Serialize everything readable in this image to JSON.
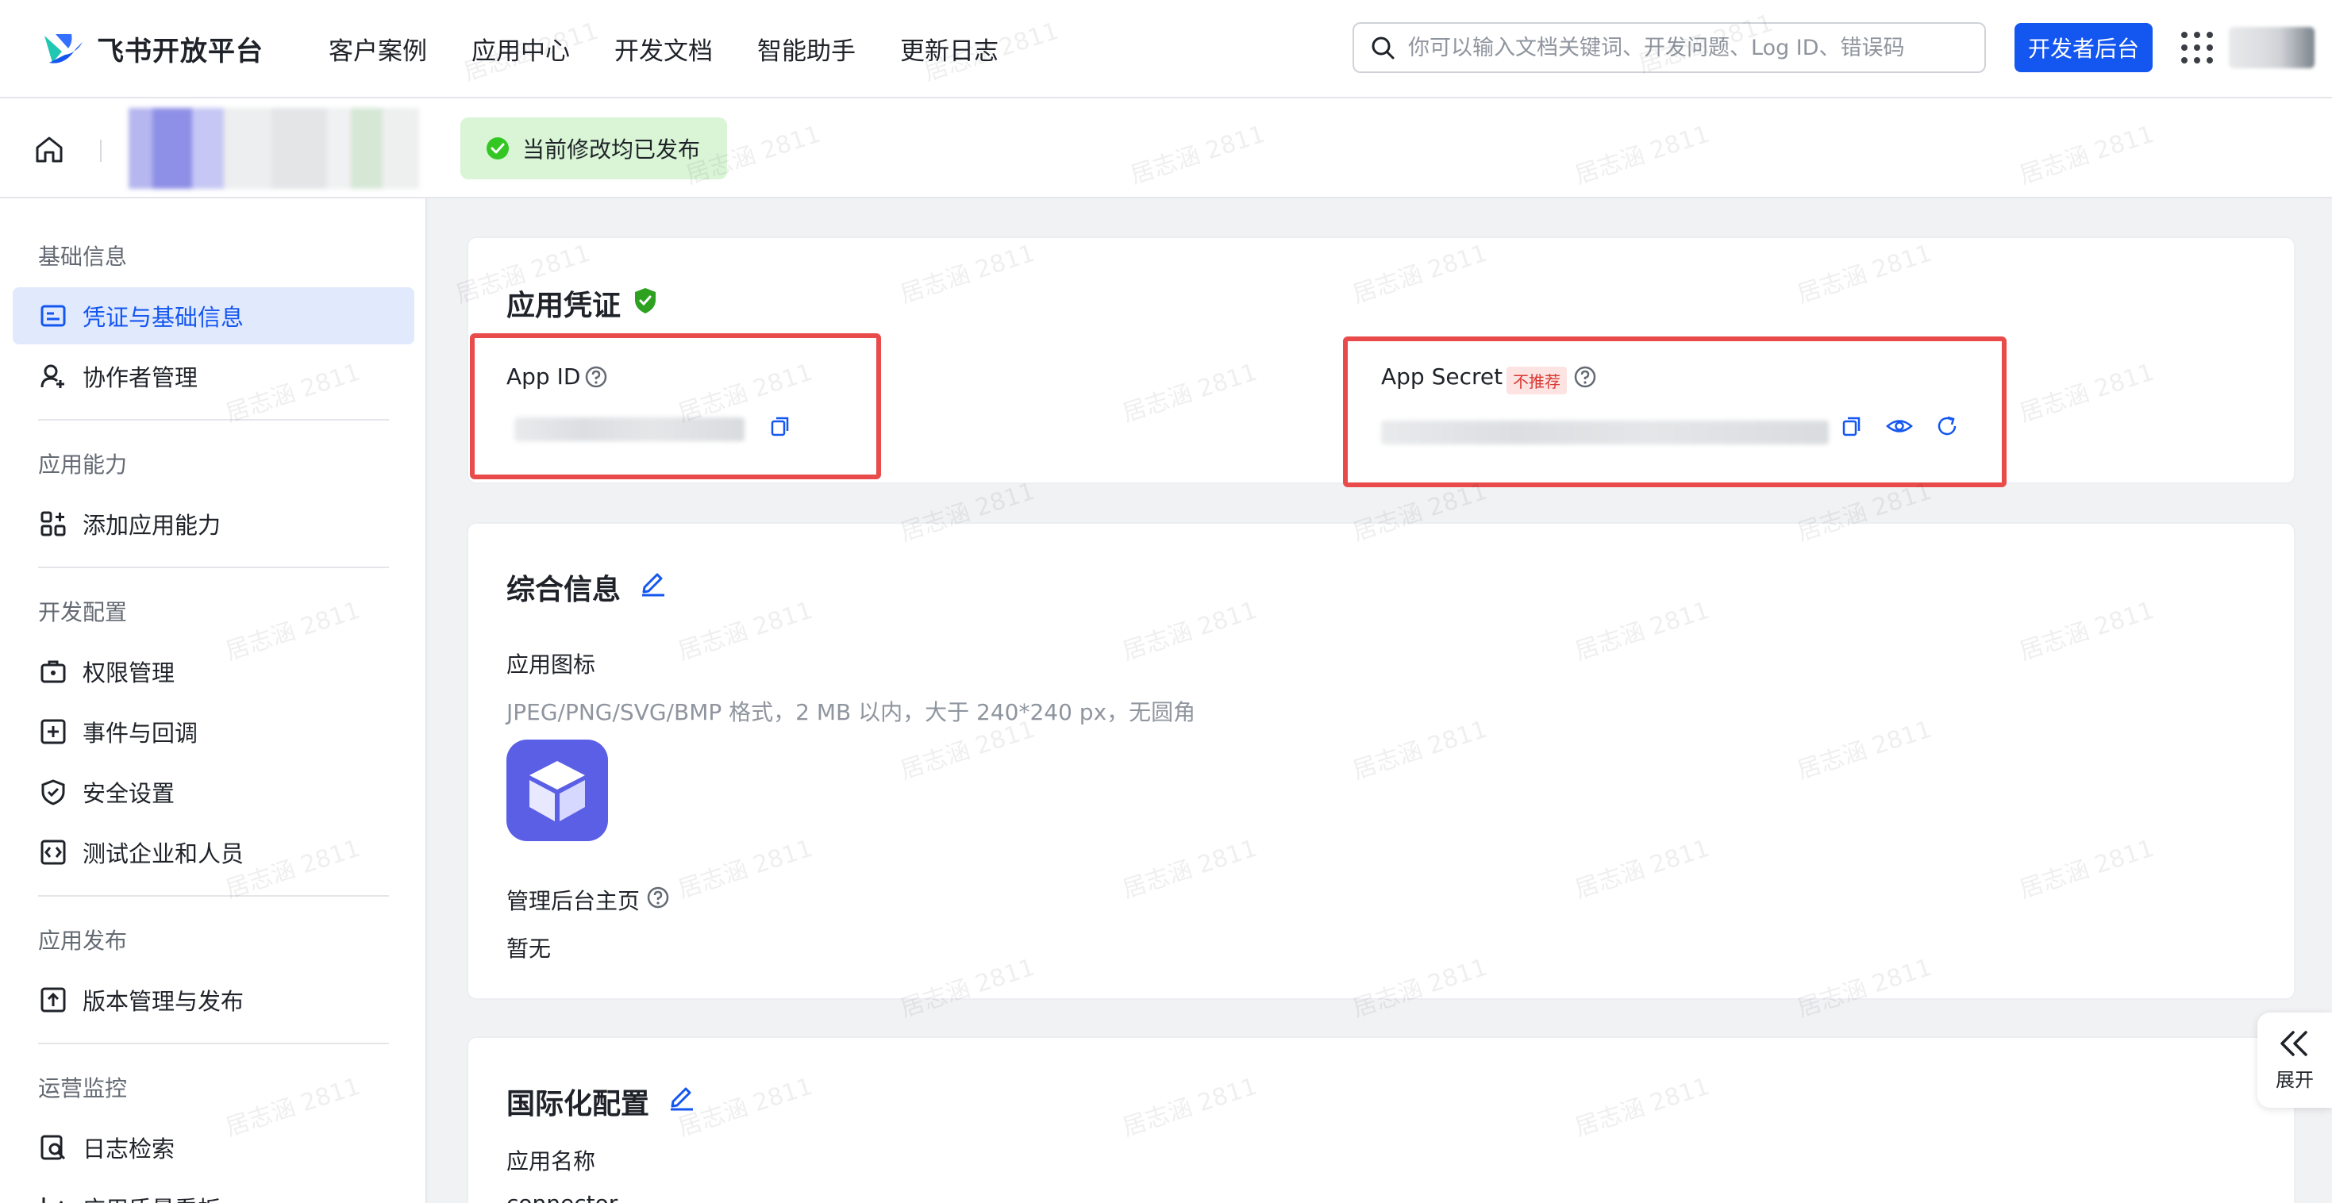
{
  "brand": {
    "name": "飞书开放平台",
    "colors": {
      "primary": "#1456f0",
      "logo_teal": "#20c7b2",
      "logo_blue": "#1456f0"
    }
  },
  "nav": {
    "items": [
      "客户案例",
      "应用中心",
      "开发文档",
      "智能助手",
      "更新日志"
    ]
  },
  "search": {
    "placeholder": "你可以输入文档关键词、开发问题、Log ID、错误码",
    "value": ""
  },
  "top_actions": {
    "developer_console": "开发者后台"
  },
  "subheader": {
    "status_text": "当前修改均已发布",
    "status_color": "#34c724"
  },
  "sidebar": {
    "sections": [
      {
        "title": "基础信息",
        "items": [
          {
            "label": "凭证与基础信息",
            "icon": "credential-icon",
            "active": true
          },
          {
            "label": "协作者管理",
            "icon": "user-add-icon"
          }
        ]
      },
      {
        "title": "应用能力",
        "items": [
          {
            "label": "添加应用能力",
            "icon": "apps-add-icon"
          }
        ]
      },
      {
        "title": "开发配置",
        "items": [
          {
            "label": "权限管理",
            "icon": "briefcase-lock-icon"
          },
          {
            "label": "事件与回调",
            "icon": "event-plus-icon"
          },
          {
            "label": "安全设置",
            "icon": "shield-check-icon"
          },
          {
            "label": "测试企业和人员",
            "icon": "code-box-icon"
          }
        ]
      },
      {
        "title": "应用发布",
        "items": [
          {
            "label": "版本管理与发布",
            "icon": "upload-box-icon"
          }
        ]
      },
      {
        "title": "运营监控",
        "items": [
          {
            "label": "日志检索",
            "icon": "log-search-icon"
          },
          {
            "label": "应用质量看板",
            "icon": "chart-icon"
          }
        ]
      }
    ]
  },
  "credentials": {
    "title": "应用凭证",
    "app_id_label": "App ID",
    "app_secret_label": "App Secret",
    "not_recommended_tag": "不推荐"
  },
  "general": {
    "title": "综合信息",
    "icon_label": "应用图标",
    "icon_hint": "JPEG/PNG/SVG/BMP 格式，2 MB 以内，大于 240*240 px，无圆角",
    "admin_home_label": "管理后台主页",
    "admin_home_value": "暂无"
  },
  "i18n": {
    "title": "国际化配置",
    "app_name_label": "应用名称",
    "app_name_value": "connector"
  },
  "expand": {
    "label": "展开"
  },
  "watermark": "居志涵 2811"
}
